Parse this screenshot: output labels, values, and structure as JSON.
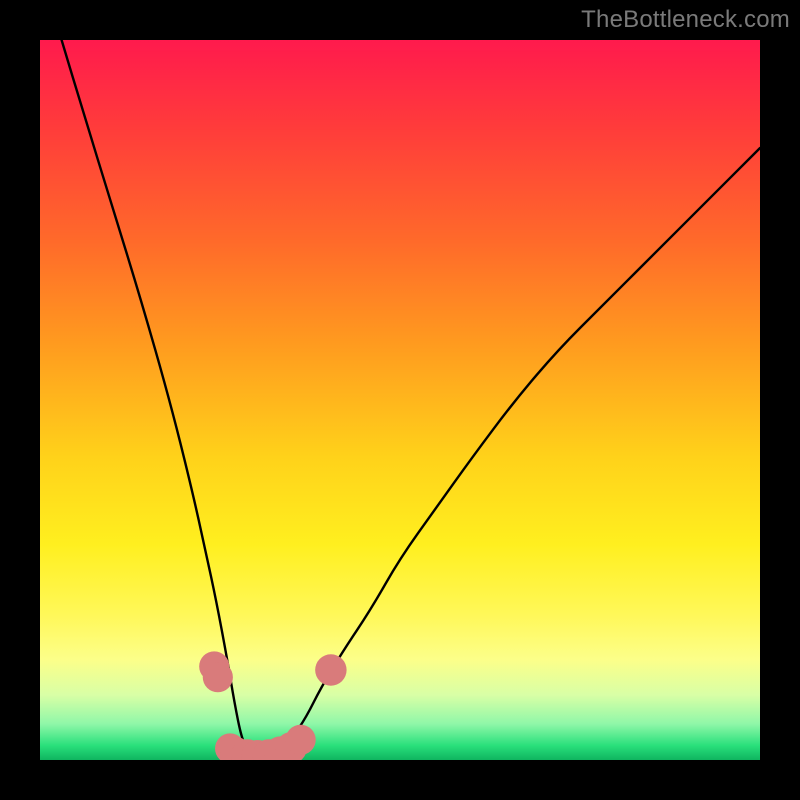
{
  "watermark": "TheBottleneck.com",
  "colors": {
    "frame": "#000000",
    "curve": "#000000",
    "markers_fill": "#d97b7b",
    "markers_stroke": "#c96a6a",
    "gradient_top": "#ff1a4d",
    "gradient_mid": "#ffd21a",
    "gradient_bottom": "#0fb45f"
  },
  "chart_data": {
    "type": "line",
    "title": "",
    "xlabel": "",
    "ylabel": "",
    "xlim": [
      0,
      100
    ],
    "ylim": [
      0,
      100
    ],
    "grid": false,
    "legend": false,
    "series": [
      {
        "name": "curve",
        "x": [
          3,
          6,
          10,
          14,
          18,
          21,
          23,
          24.5,
          26,
          27,
          28,
          29,
          30,
          31.5,
          33,
          35,
          37,
          39,
          42,
          46,
          50,
          55,
          60,
          66,
          72,
          78,
          85,
          92,
          100
        ],
        "y": [
          100,
          90,
          77,
          64,
          50,
          38,
          29,
          22,
          14,
          8,
          3,
          1,
          0.5,
          0.5,
          1,
          3,
          6,
          10,
          15,
          21,
          28,
          35,
          42,
          50,
          57,
          63,
          70,
          77,
          85
        ]
      }
    ],
    "markers": [
      {
        "x": 24.2,
        "y": 13,
        "r": 1.4
      },
      {
        "x": 24.7,
        "y": 11.5,
        "r": 1.4
      },
      {
        "x": 26.4,
        "y": 1.6,
        "r": 1.4
      },
      {
        "x": 27.2,
        "y": 1.1,
        "r": 1.4
      },
      {
        "x": 28.8,
        "y": 0.6,
        "r": 1.6
      },
      {
        "x": 30.2,
        "y": 0.5,
        "r": 1.6
      },
      {
        "x": 31.8,
        "y": 0.6,
        "r": 1.6
      },
      {
        "x": 33.4,
        "y": 1.0,
        "r": 1.6
      },
      {
        "x": 34.9,
        "y": 1.7,
        "r": 1.5
      },
      {
        "x": 36.2,
        "y": 2.8,
        "r": 1.4
      },
      {
        "x": 40.4,
        "y": 12.5,
        "r": 1.5
      }
    ]
  }
}
